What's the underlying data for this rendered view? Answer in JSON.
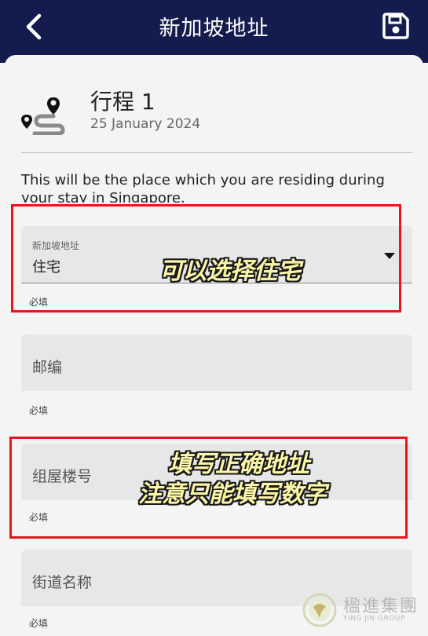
{
  "header": {
    "title": "新加坡地址",
    "back_icon": "chevron-left-icon",
    "save_icon": "save-icon"
  },
  "trip": {
    "title": "行程 1",
    "date": "25 January 2024",
    "icon": "route-icon"
  },
  "intro_text": "This will be the place which you are residing during your stay in Singapore.",
  "fields": [
    {
      "label": "新加坡地址",
      "value": "住宅",
      "required": "必填"
    },
    {
      "placeholder": "邮编",
      "required": "必填"
    },
    {
      "placeholder": "组屋楼号",
      "required": "必填"
    },
    {
      "placeholder": "街道名称",
      "required": "必填"
    }
  ],
  "annotations": {
    "note1": "可以选择住宅",
    "note2_line1": "填写正确地址",
    "note2_line2": "注意只能填写数字"
  },
  "watermark": {
    "name": "楹進集團",
    "sub": "YING JIN GROUP"
  },
  "colors": {
    "header_bg": "#141b4d",
    "highlight": "#e8141e",
    "note_text": "#fdf6a8"
  }
}
